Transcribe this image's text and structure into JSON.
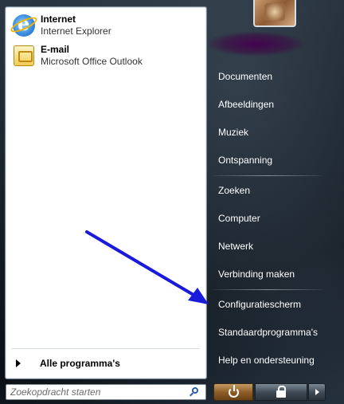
{
  "pinned": [
    {
      "title": "Internet",
      "subtitle": "Internet Explorer",
      "icon": "internet-explorer-icon"
    },
    {
      "title": "E-mail",
      "subtitle": "Microsoft Office Outlook",
      "icon": "outlook-icon"
    }
  ],
  "all_programs": {
    "label": "Alle programma's",
    "icon": "arrow-right-icon"
  },
  "search": {
    "placeholder": "Zoekopdracht starten",
    "icon": "search-icon"
  },
  "right_links": {
    "documents": "Documenten",
    "pictures": "Afbeeldingen",
    "music": "Muziek",
    "games": "Ontspanning",
    "search": "Zoeken",
    "computer": "Computer",
    "network": "Netwerk",
    "connect_to": "Verbinding maken",
    "control_panel": "Configuratiescherm",
    "default_programs": "Standaardprogramma's",
    "help": "Help en ondersteuning"
  },
  "power": {
    "power_icon": "power-icon",
    "lock_icon": "lock-icon",
    "options_icon": "chevron-right-icon"
  },
  "colors": {
    "annotation_arrow": "#1a1adb",
    "username_smudge": "#46004f",
    "power_button": "#a06c34"
  }
}
